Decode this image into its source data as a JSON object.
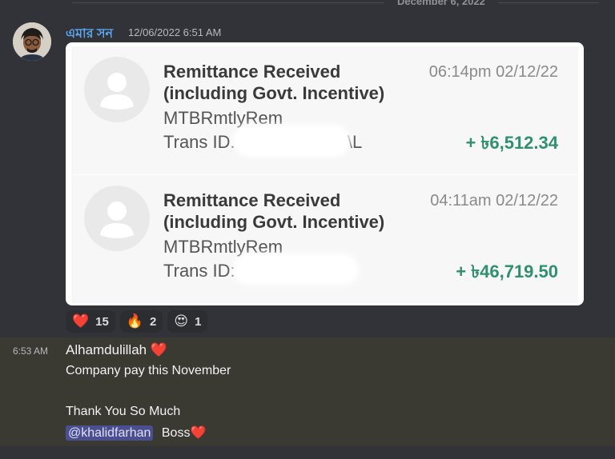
{
  "divider": {
    "date": "December 6, 2022"
  },
  "message1": {
    "username": "এমার সন",
    "timestamp": "12/06/2022 6:51 AM",
    "sms": [
      {
        "title_line1": "Remittance Received",
        "title_line2": "(including Govt. Incentive)",
        "sender": "MTBRmtlyRem",
        "trans_label": "Trans ID.",
        "trans_visible_suffix": "\\L",
        "time": "06:14pm 02/12/22",
        "amount": "+ ৳6,512.34"
      },
      {
        "title_line1": "Remittance Received",
        "title_line2": "(including Govt. Incentive)",
        "sender": "MTBRmtlyRem",
        "trans_label": "Trans ID:",
        "trans_visible_suffix": "",
        "time": "04:11am 02/12/22",
        "amount": "+ ৳46,719.50"
      }
    ],
    "reactions": [
      {
        "emoji": "❤️",
        "icon": "heart-icon",
        "count": "15"
      },
      {
        "emoji": "🔥",
        "icon": "fire-icon",
        "count": "2"
      },
      {
        "emoji": "😍",
        "icon": "heart-eyes-icon",
        "count": "1"
      }
    ]
  },
  "message2": {
    "timestamp": "6:53 AM",
    "line1": "Alhamdulillah",
    "line2": "Company pay this November",
    "line3": "Thank You So Much",
    "mention": "@khalidfarhan",
    "line4_suffix": "Boss"
  },
  "colors": {
    "background": "#313338",
    "username": "#5aa6ef",
    "amount": "#2f8f6f",
    "mention_bg": "#4b4e8f",
    "highlight_bg": "#3a3932"
  }
}
